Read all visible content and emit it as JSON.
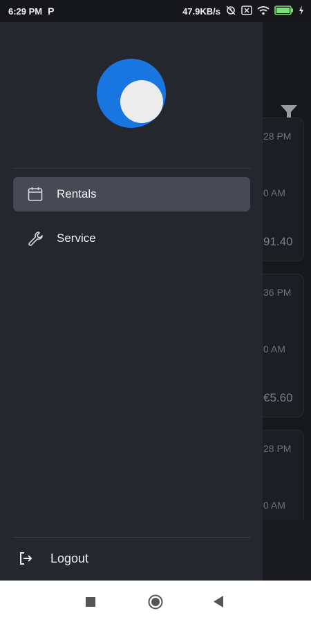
{
  "status_bar": {
    "time": "6:29 PM",
    "carrier_icon": "P",
    "speed": "47.9KB/s",
    "battery_color": "#7ee07a"
  },
  "drawer": {
    "avatar_color": "#1976e0",
    "nav_items": [
      {
        "label": "Rentals",
        "icon": "calendar-icon",
        "active": true
      },
      {
        "label": "Service",
        "icon": "wrench-icon",
        "active": false
      }
    ],
    "logout_label": "Logout"
  },
  "background": {
    "cards": [
      {
        "time_top": "28 PM",
        "time_mid": "0 AM",
        "amount": "91.40"
      },
      {
        "time_top": "36 PM",
        "time_mid": "0 AM",
        "amount": "€5.60"
      },
      {
        "time_top": "28 PM",
        "time_mid": "0 AM"
      }
    ]
  },
  "colors": {
    "accent": "#1976e0",
    "drawer_bg": "#25272e",
    "active_item_bg": "#474a54"
  }
}
